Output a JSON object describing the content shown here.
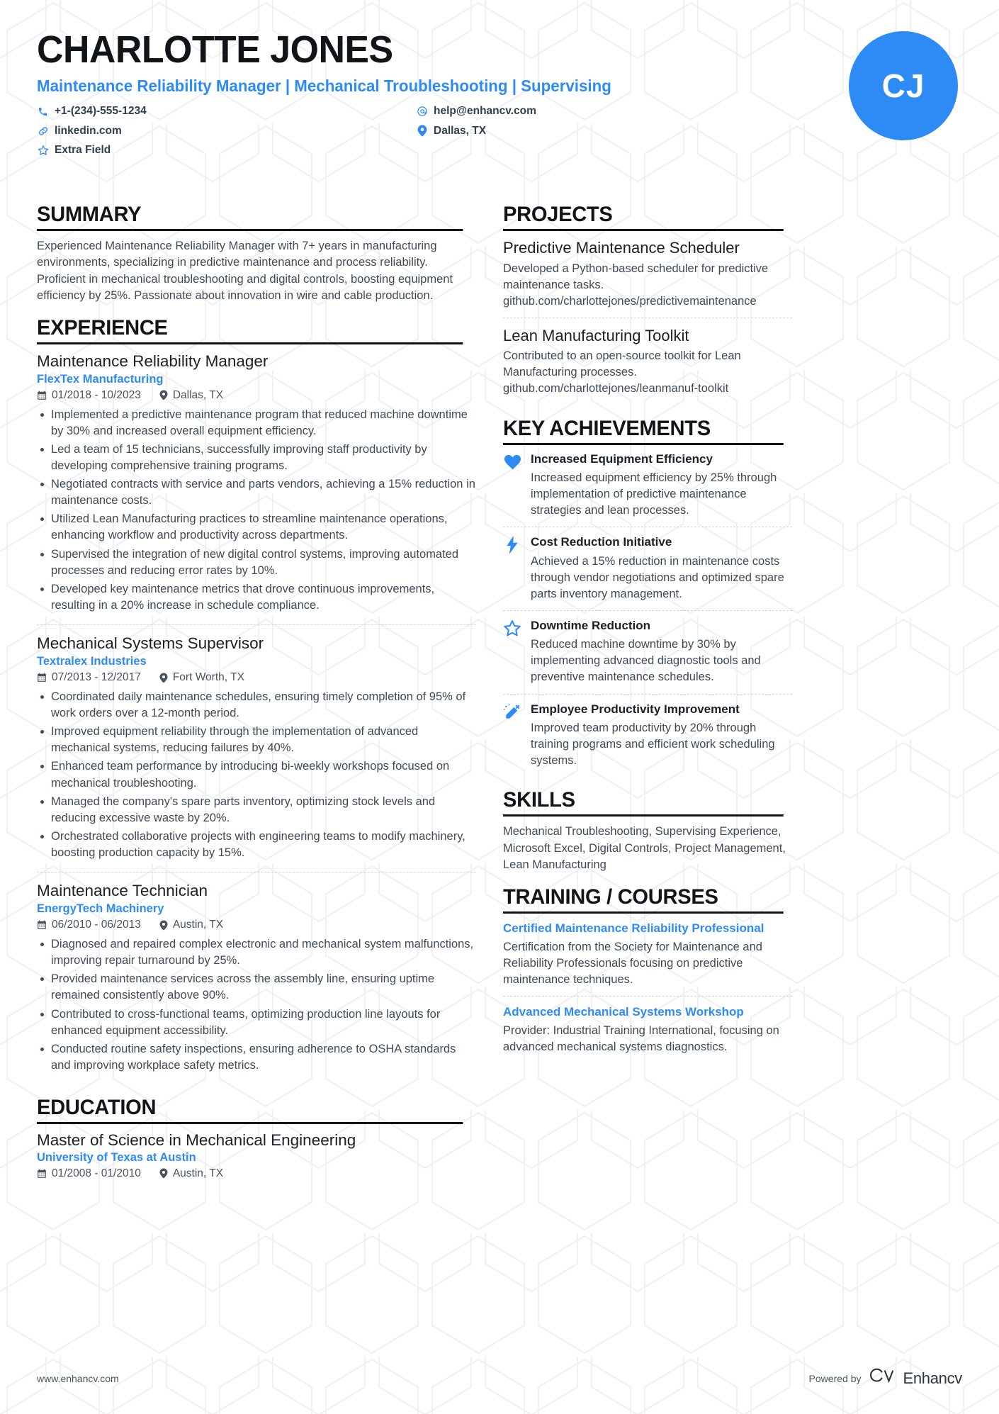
{
  "header": {
    "name": "CHARLOTTE JONES",
    "headline": "Maintenance Reliability Manager | Mechanical Troubleshooting | Supervising",
    "avatar_initials": "CJ",
    "accent_color": "#2E8BF6",
    "contacts": [
      {
        "icon": "phone-icon",
        "glyph": "✆",
        "text": "+1-(234)-555-1234"
      },
      {
        "icon": "email-icon",
        "glyph": "@",
        "text": "help@enhancv.com"
      },
      {
        "icon": "link-icon",
        "glyph": "ὑ7",
        "text": "linkedin.com"
      },
      {
        "icon": "location-pin-icon",
        "glyph": "•",
        "text": "Dallas, TX"
      },
      {
        "icon": "star-icon",
        "glyph": "☆",
        "text": "Extra Field"
      }
    ]
  },
  "sections": {
    "summary": {
      "title": "SUMMARY",
      "text": "Experienced Maintenance Reliability Manager with 7+ years in manufacturing environments, specializing in predictive maintenance and process reliability. Proficient in mechanical troubleshooting and digital controls, boosting equipment efficiency by 25%. Passionate about innovation in wire and cable production."
    },
    "experience": {
      "title": "EXPERIENCE",
      "entries": [
        {
          "role": "Maintenance Reliability Manager",
          "company": "FlexTex Manufacturing",
          "dates": "01/2018 - 10/2023",
          "location": "Dallas, TX",
          "bullets": [
            "Implemented a predictive maintenance program that reduced machine downtime by 30% and increased overall equipment efficiency.",
            "Led a team of 15 technicians, successfully improving staff productivity by developing comprehensive training programs.",
            "Negotiated contracts with service and parts vendors, achieving a 15% reduction in maintenance costs.",
            "Utilized Lean Manufacturing practices to streamline maintenance operations, enhancing workflow and productivity across departments.",
            "Supervised the integration of new digital control systems, improving automated processes and reducing error rates by 10%.",
            "Developed key maintenance metrics that drove continuous improvements, resulting in a 20% increase in schedule compliance."
          ]
        },
        {
          "role": "Mechanical Systems Supervisor",
          "company": "Textralex Industries",
          "dates": "07/2013 - 12/2017",
          "location": "Fort Worth, TX",
          "bullets": [
            "Coordinated daily maintenance schedules, ensuring timely completion of 95% of work orders over a 12-month period.",
            "Improved equipment reliability through the implementation of advanced mechanical systems, reducing failures by 40%.",
            "Enhanced team performance by introducing bi-weekly workshops focused on mechanical troubleshooting.",
            "Managed the company's spare parts inventory, optimizing stock levels and reducing excessive waste by 20%.",
            "Orchestrated collaborative projects with engineering teams to modify machinery, boosting production capacity by 15%."
          ]
        },
        {
          "role": "Maintenance Technician",
          "company": "EnergyTech Machinery",
          "dates": "06/2010 - 06/2013",
          "location": "Austin, TX",
          "bullets": [
            "Diagnosed and repaired complex electronic and mechanical system malfunctions, improving repair turnaround by 25%.",
            "Provided maintenance services across the assembly line, ensuring uptime remained consistently above 90%.",
            "Contributed to cross-functional teams, optimizing production line layouts for enhanced equipment accessibility.",
            "Conducted routine safety inspections, ensuring adherence to OSHA standards and improving workplace safety metrics."
          ]
        }
      ]
    },
    "education": {
      "title": "EDUCATION",
      "entries": [
        {
          "degree": "Master of Science in Mechanical Engineering",
          "school": "University of Texas at Austin",
          "dates": "01/2008 - 01/2010",
          "location": "Austin, TX"
        }
      ]
    },
    "projects": {
      "title": "PROJECTS",
      "entries": [
        {
          "name": "Predictive Maintenance Scheduler",
          "description": "Developed a Python-based scheduler for predictive maintenance tasks. github.com/charlottejones/predictivemaintenance"
        },
        {
          "name": "Lean Manufacturing Toolkit",
          "description": "Contributed to an open-source toolkit for Lean Manufacturing processes. github.com/charlottejones/leanmanuf-toolkit"
        }
      ]
    },
    "key_achievements": {
      "title": "KEY ACHIEVEMENTS",
      "entries": [
        {
          "icon": "heart-icon",
          "title": "Increased Equipment Efficiency",
          "description": "Increased equipment efficiency by 25% through implementation of predictive maintenance strategies and lean processes."
        },
        {
          "icon": "lightning-bolt-icon",
          "title": "Cost Reduction Initiative",
          "description": "Achieved a 15% reduction in maintenance costs through vendor negotiations and optimized spare parts inventory management."
        },
        {
          "icon": "star-outline-icon",
          "title": "Downtime Reduction",
          "description": "Reduced machine downtime by 30% by implementing advanced diagnostic tools and preventive maintenance schedules."
        },
        {
          "icon": "magic-wand-icon",
          "title": "Employee Productivity Improvement",
          "description": "Improved team productivity by 20% through training programs and efficient work scheduling systems."
        }
      ]
    },
    "skills": {
      "title": "SKILLS",
      "text": "Mechanical Troubleshooting, Supervising Experience, Microsoft Excel, Digital Controls, Project Management, Lean Manufacturing"
    },
    "training": {
      "title": "TRAINING / COURSES",
      "entries": [
        {
          "name": "Certified Maintenance Reliability Professional",
          "description": "Certification from the Society for Maintenance and Reliability Professionals focusing on predictive maintenance techniques."
        },
        {
          "name": "Advanced Mechanical Systems Workshop",
          "description": "Provider: Industrial Training International, focusing on advanced mechanical systems diagnostics."
        }
      ]
    }
  },
  "footer": {
    "url": "www.enhancv.com",
    "powered_by": "Powered by",
    "brand": "Enhancv"
  }
}
